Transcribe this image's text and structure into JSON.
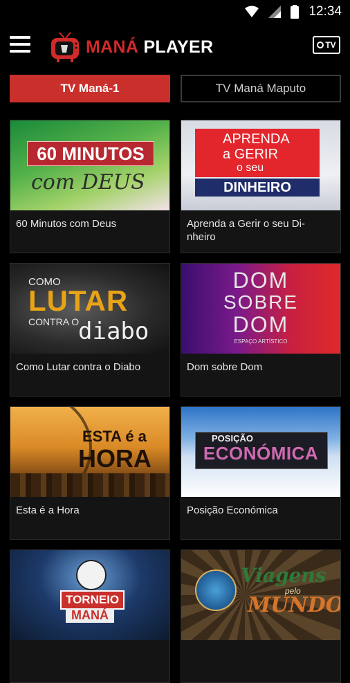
{
  "status": {
    "time": "12:34",
    "icons": [
      "wifi-icon",
      "signal-icon",
      "battery-icon"
    ]
  },
  "header": {
    "logo_mana": "MANÁ",
    "logo_player": "PLAYER",
    "tv_label": "TV"
  },
  "tabs": [
    {
      "label": "TV Maná-1",
      "active": true
    },
    {
      "label": "TV Maná Maputo",
      "active": false
    }
  ],
  "programs": [
    {
      "title": "60 Minutos com Deus",
      "thumb_lines": [
        "60 MINUTOS",
        "com DEUS"
      ]
    },
    {
      "title": "Aprenda a Gerir o seu Di-\nnheiro",
      "thumb_lines": [
        "APRENDA",
        "a GERIR",
        "o seu",
        "DINHEIRO"
      ]
    },
    {
      "title": "Como Lutar contra o Diabo",
      "thumb_lines": [
        "COMO",
        "LUTAR",
        "CONTRA O",
        "diabo"
      ]
    },
    {
      "title": "Dom sobre Dom",
      "thumb_lines": [
        "DOM",
        "SOBRE",
        "DOM",
        "ESPAÇO ARTÍSTICO"
      ]
    },
    {
      "title": "Esta é a Hora",
      "thumb_lines": [
        "ESTA é a",
        "HORA"
      ]
    },
    {
      "title": "Posição Económica",
      "thumb_lines": [
        "POSIÇÃO",
        "ECONÓMICA"
      ]
    },
    {
      "title": "",
      "thumb_lines": [
        "TORNEIO",
        "MANÁ"
      ]
    },
    {
      "title": "",
      "thumb_lines": [
        "Viagens",
        "pelo",
        "MUNDO"
      ]
    }
  ],
  "colors": {
    "accent": "#c9302c",
    "background": "#000000",
    "card": "#141414"
  }
}
